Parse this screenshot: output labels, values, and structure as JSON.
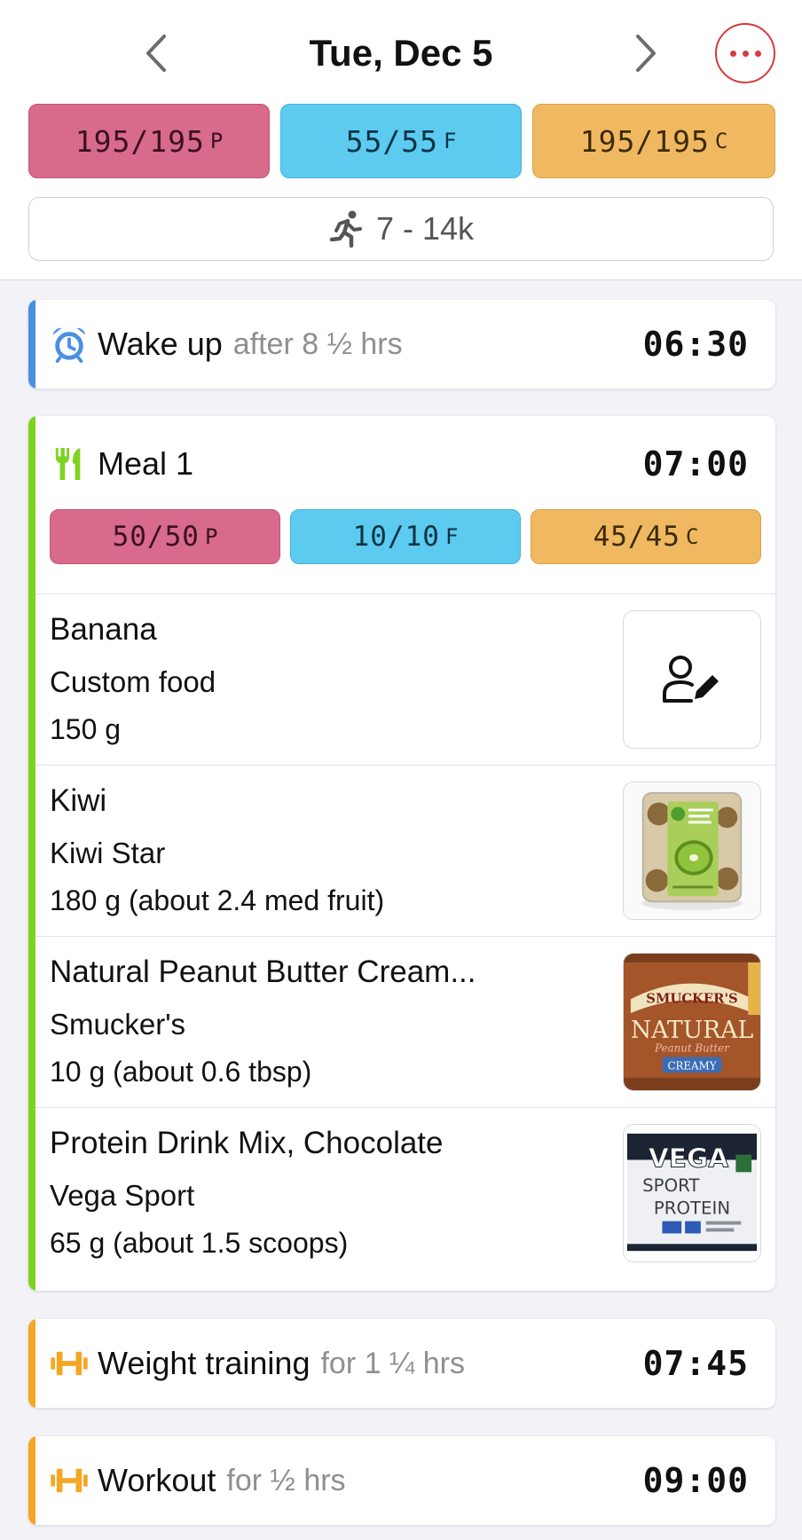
{
  "header": {
    "date": "Tue, Dec 5",
    "prev_icon": "chevron-left-icon",
    "next_icon": "chevron-right-icon",
    "more_icon": "ellipsis-icon",
    "macros": {
      "protein": {
        "value": "195/195",
        "unit": "P"
      },
      "fat": {
        "value": "55/55",
        "unit": "F"
      },
      "carbs": {
        "value": "195/195",
        "unit": "C"
      }
    },
    "steps": {
      "icon": "runner-icon",
      "label": "7 - 14k"
    }
  },
  "events": {
    "wake": {
      "icon": "alarm-clock-icon",
      "title": "Wake up",
      "subtitle": "after 8 ½ hrs",
      "time": "06:30"
    },
    "weights": {
      "icon": "dumbbell-icon",
      "title": "Weight training",
      "subtitle": "for 1 ¼ hrs",
      "time": "07:45"
    },
    "workout": {
      "icon": "dumbbell-icon",
      "title": "Workout",
      "subtitle": "for ½ hrs",
      "time": "09:00"
    }
  },
  "meal": {
    "icon": "fork-knife-icon",
    "title": "Meal 1",
    "time": "07:00",
    "macros": {
      "protein": {
        "value": "50/50",
        "unit": "P"
      },
      "fat": {
        "value": "10/10",
        "unit": "F"
      },
      "carbs": {
        "value": "45/45",
        "unit": "C"
      }
    },
    "foods": [
      {
        "name": "Banana",
        "brand": "Custom food",
        "amount": "150 g",
        "thumb": "custom-food-user-edit-icon"
      },
      {
        "name": "Kiwi",
        "brand": "Kiwi Star",
        "amount": "180 g (about 2.4 med fruit)",
        "thumb": "kiwi-package-image"
      },
      {
        "name": "Natural Peanut Butter Cream...",
        "brand": "Smucker's",
        "amount": "10 g (about 0.6 tbsp)",
        "thumb": "peanut-butter-jar-image",
        "thumb_text": {
          "brand": "SMUCKER'S",
          "line1": "NATURAL",
          "line2": "Peanut Butter",
          "line3": "CREAMY"
        }
      },
      {
        "name": "Protein Drink Mix, Chocolate",
        "brand": "Vega Sport",
        "amount": "65 g (about 1.5 scoops)",
        "thumb": "protein-tub-image",
        "thumb_text": {
          "brand": "VEGA",
          "line1": "SPORT",
          "line2": "PROTEIN"
        }
      }
    ]
  },
  "colors": {
    "protein": "#d86a8c",
    "fat": "#5ccbef",
    "carbs": "#f0b961",
    "wake_bar": "#4a90e2",
    "meal_bar": "#7ed321",
    "training_bar": "#f5a623",
    "accent_red": "#d9383c"
  }
}
